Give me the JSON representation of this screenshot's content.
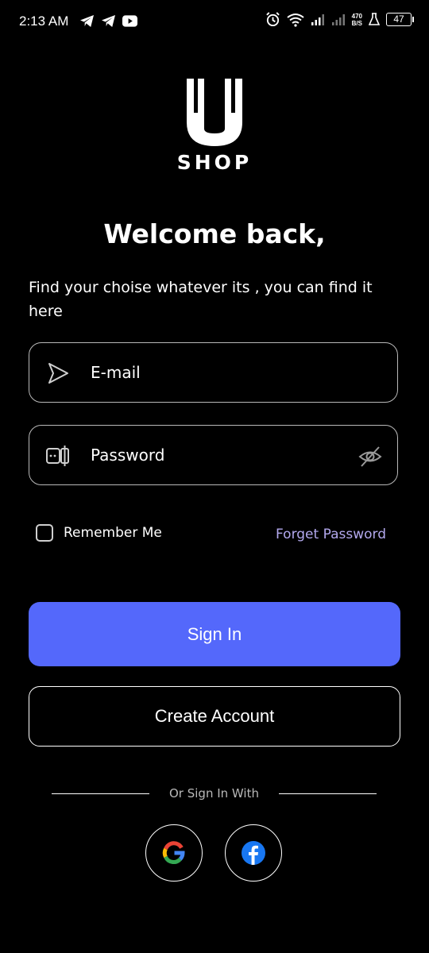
{
  "status_bar": {
    "time": "2:13 AM",
    "left_icons": [
      "telegram-icon",
      "telegram-icon",
      "youtube-icon"
    ],
    "right_icons": [
      "alarm-icon",
      "wifi-icon",
      "signal-icon",
      "signal-icon",
      "network-speed",
      "lab-icon",
      "battery-icon"
    ],
    "network_speed_value": "470",
    "network_speed_unit": "B/S",
    "battery": "47"
  },
  "logo": {
    "letter": "U",
    "text": "SHOP"
  },
  "welcome": {
    "title": "Welcome back,",
    "subtitle": "Find your choise whatever its , you can find it here"
  },
  "form": {
    "email_placeholder": "E-mail",
    "email_value": "",
    "email_icon": "send-arrow-icon",
    "password_placeholder": "Password",
    "password_value": "",
    "password_icon": "password-icon",
    "password_toggle_icon": "eye-off-icon",
    "remember_label": "Remember Me",
    "remember_checked": false,
    "forget_label": "Forget Password"
  },
  "actions": {
    "sign_in": "Sign In",
    "create_account": "Create Account"
  },
  "social": {
    "divider_text": "Or Sign In With",
    "providers": [
      "google-icon",
      "facebook-icon"
    ]
  },
  "colors": {
    "background": "#000000",
    "primary": "#5468fb",
    "link": "#b3a9ee",
    "border": "#b9b9b9"
  }
}
